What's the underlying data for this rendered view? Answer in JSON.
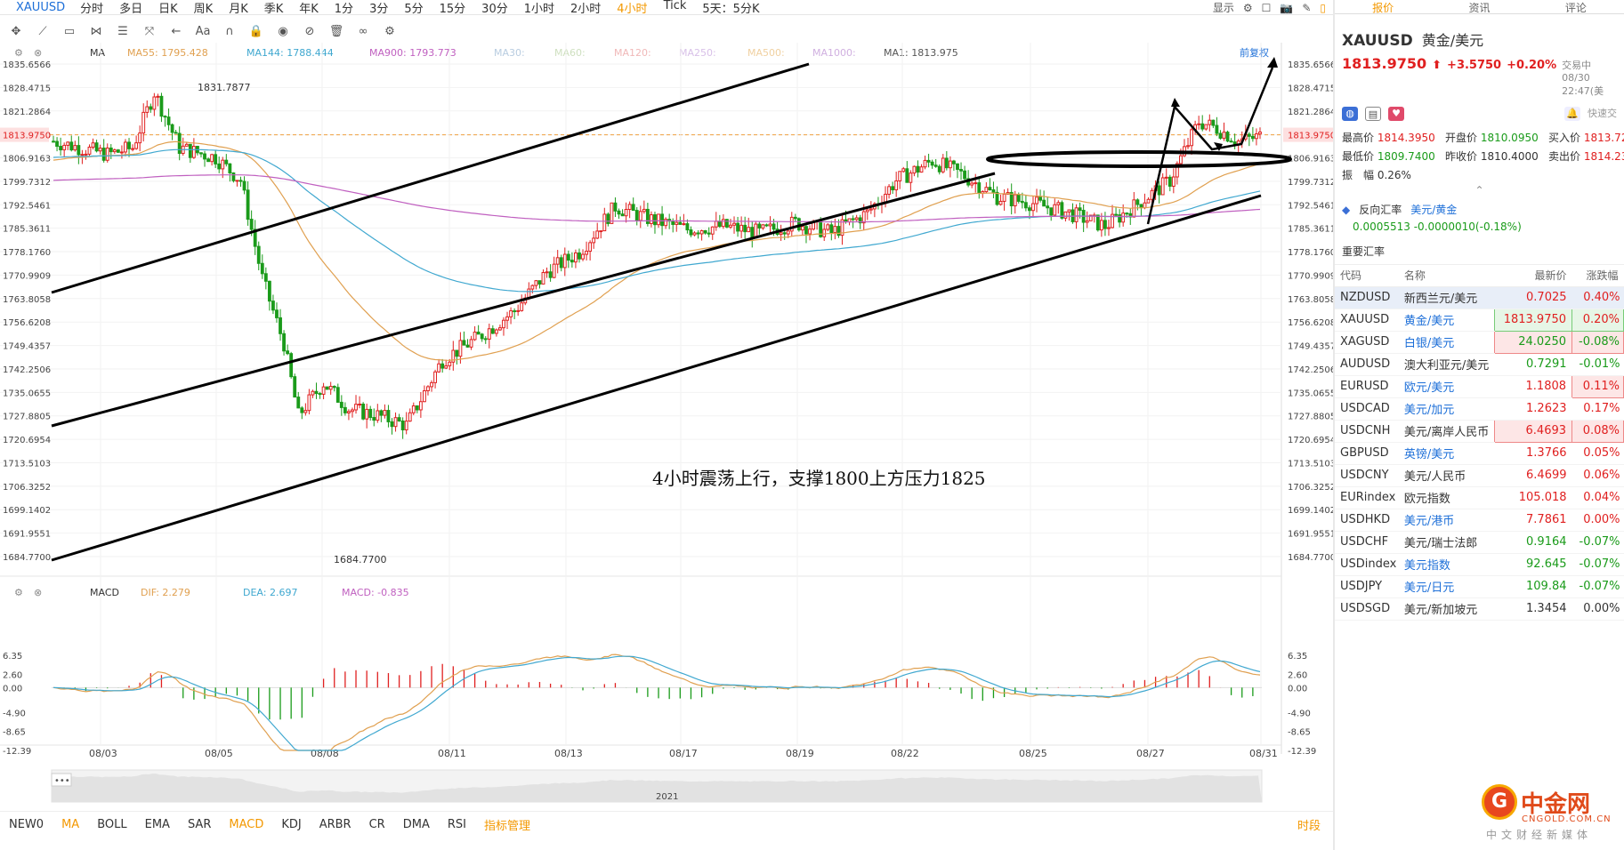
{
  "topbar": {
    "symbol": "XAUUSD",
    "periods": [
      "分时",
      "多日",
      "日K",
      "周K",
      "月K",
      "季K",
      "年K",
      "1分",
      "3分",
      "5分",
      "15分",
      "30分",
      "1小时",
      "2小时",
      "4小时",
      "Tick",
      "5天：5分K"
    ],
    "active_period": "4小时",
    "display_label": "显示"
  },
  "chart_legend": {
    "ma_label": "MA",
    "ma55": "MA55: 1795.428",
    "ma144": "MA144: 1788.444",
    "ma900": "MA900: 1793.773",
    "ma30": "MA30:",
    "ma60": "MA60:",
    "ma120": "MA120:",
    "ma250": "MA250:",
    "ma500": "MA500:",
    "ma1000": "MA1000:",
    "ma1": "MA1: 1813.975",
    "restore": "前复权",
    "macd_label": "MACD",
    "dif": "DIF: 2.279",
    "dea": "DEA: 2.697",
    "macd": "MACD: -0.835",
    "year": "2021"
  },
  "annotation": {
    "text": "4小时震荡上行，支撑1800上方压力1825",
    "high_label": "1831.7877",
    "low_label": "1684.7700",
    "current_price_tag": "1813.9750"
  },
  "chart_data": {
    "type": "candlestick",
    "price_axis": [
      "1835.6566",
      "1828.4715",
      "1821.2864",
      "1813.9750",
      "1806.9163",
      "1799.7312",
      "1792.5461",
      "1785.3611",
      "1778.1760",
      "1770.9909",
      "1763.8058",
      "1756.6208",
      "1749.4357",
      "1742.2506",
      "1735.0655",
      "1727.8805",
      "1720.6954",
      "1713.5103",
      "1706.3252",
      "1699.1402",
      "1691.9551",
      "1684.7700"
    ],
    "price_range": [
      1684.77,
      1835.6566
    ],
    "macd_axis": [
      "6.35",
      "2.60",
      "0.00",
      "-4.90",
      "-8.65",
      "-12.39"
    ],
    "macd_range": [
      -12.39,
      9
    ],
    "date_ticks": [
      "08/03",
      "08/05",
      "08/08",
      "08/11",
      "08/13",
      "08/17",
      "08/19",
      "08/22",
      "08/25",
      "08/27",
      "08/31"
    ],
    "colors": {
      "up": "#e02020",
      "down": "#1a9b1a",
      "ma55": "#e0a050",
      "ma144": "#40a8d0",
      "ma900": "#c060c0"
    }
  },
  "bottombar": {
    "indicators": [
      "NEW0",
      "MA",
      "BOLL",
      "EMA",
      "SAR",
      "MACD",
      "KDJ",
      "ARBR",
      "CR",
      "DMA",
      "RSI"
    ],
    "active_indicators": [
      "MA",
      "MACD"
    ],
    "manage": "指标管理",
    "period_right": "时段"
  },
  "side": {
    "tabs": [
      "报价",
      "资讯",
      "评论"
    ],
    "symbol": "XAUUSD",
    "name": "黄金/美元",
    "price": "1813.9750",
    "arrow": "⬆",
    "change": "+3.5750",
    "change_pct": "+0.20%",
    "timestamp": "交易中 08/30 22:47(美",
    "compare_label": "快速交",
    "stats": [
      {
        "label": "最高价",
        "value": "1814.3950",
        "cls": "v"
      },
      {
        "label": "开盘价",
        "value": "1810.0950",
        "cls": "g"
      },
      {
        "label": "买入价",
        "value": "1813.72",
        "cls": "v"
      },
      {
        "label": "最低价",
        "value": "1809.7400",
        "cls": "g"
      },
      {
        "label": "昨收价",
        "value": "1810.4000",
        "cls": ""
      },
      {
        "label": "卖出价",
        "value": "1814.23",
        "cls": "v"
      },
      {
        "label": "振　幅",
        "value": "0.26%",
        "cls": ""
      }
    ],
    "cross_label": "反向汇率",
    "cross_pair": "美元/黄金",
    "cross_value": "0.0005513  -0.0000010(-0.18%)",
    "section": "重要汇率",
    "headers": [
      "代码",
      "名称",
      "最新价",
      "涨跌幅"
    ],
    "rows": [
      {
        "code": "NZDUSD",
        "name": "新西兰元/美元",
        "last": "0.7025",
        "pct": "0.40%",
        "dir": "up",
        "sel": true,
        "box": ""
      },
      {
        "code": "XAUUSD",
        "name": "黄金/美元",
        "last": "1813.9750",
        "pct": "0.20%",
        "dir": "up",
        "sel": false,
        "box": "dn"
      },
      {
        "code": "XAGUSD",
        "name": "白银/美元",
        "last": "24.0250",
        "pct": "-0.08%",
        "dir": "dn",
        "sel": false,
        "box": "up"
      },
      {
        "code": "AUDUSD",
        "name": "澳大利亚元/美元",
        "last": "0.7291",
        "pct": "-0.01%",
        "dir": "dn",
        "sel": false,
        "box": ""
      },
      {
        "code": "EURUSD",
        "name": "欧元/美元",
        "last": "1.1808",
        "pct": "0.11%",
        "dir": "up",
        "sel": false,
        "box": "pup"
      },
      {
        "code": "USDCAD",
        "name": "美元/加元",
        "last": "1.2623",
        "pct": "0.17%",
        "dir": "up",
        "sel": false,
        "box": ""
      },
      {
        "code": "USDCNH",
        "name": "美元/离岸人民币",
        "last": "6.4693",
        "pct": "0.08%",
        "dir": "up",
        "sel": false,
        "box": "up"
      },
      {
        "code": "GBPUSD",
        "name": "英镑/美元",
        "last": "1.3766",
        "pct": "0.05%",
        "dir": "up",
        "sel": false,
        "box": ""
      },
      {
        "code": "USDCNY",
        "name": "美元/人民币",
        "last": "6.4699",
        "pct": "0.06%",
        "dir": "up",
        "sel": false,
        "box": ""
      },
      {
        "code": "EURindex",
        "name": "欧元指数",
        "last": "105.018",
        "pct": "0.04%",
        "dir": "up",
        "sel": false,
        "box": ""
      },
      {
        "code": "USDHKD",
        "name": "美元/港币",
        "last": "7.7861",
        "pct": "0.00%",
        "dir": "up",
        "sel": false,
        "box": ""
      },
      {
        "code": "USDCHF",
        "name": "美元/瑞士法郎",
        "last": "0.9164",
        "pct": "-0.07%",
        "dir": "dn",
        "sel": false,
        "box": ""
      },
      {
        "code": "USDindex",
        "name": "美元指数",
        "last": "92.645",
        "pct": "-0.07%",
        "dir": "dn",
        "sel": false,
        "box": ""
      },
      {
        "code": "USDJPY",
        "name": "美元/日元",
        "last": "109.84",
        "pct": "-0.07%",
        "dir": "dn",
        "sel": false,
        "box": ""
      },
      {
        "code": "USDSGD",
        "name": "美元/新加坡元",
        "last": "1.3454",
        "pct": "0.00%",
        "dir": "flat",
        "sel": false,
        "box": ""
      }
    ]
  },
  "logo": {
    "mark": "G",
    "cn": "中金网",
    "en": "CNGOLD.COM.CN",
    "tagline": "中文财经新媒体"
  }
}
